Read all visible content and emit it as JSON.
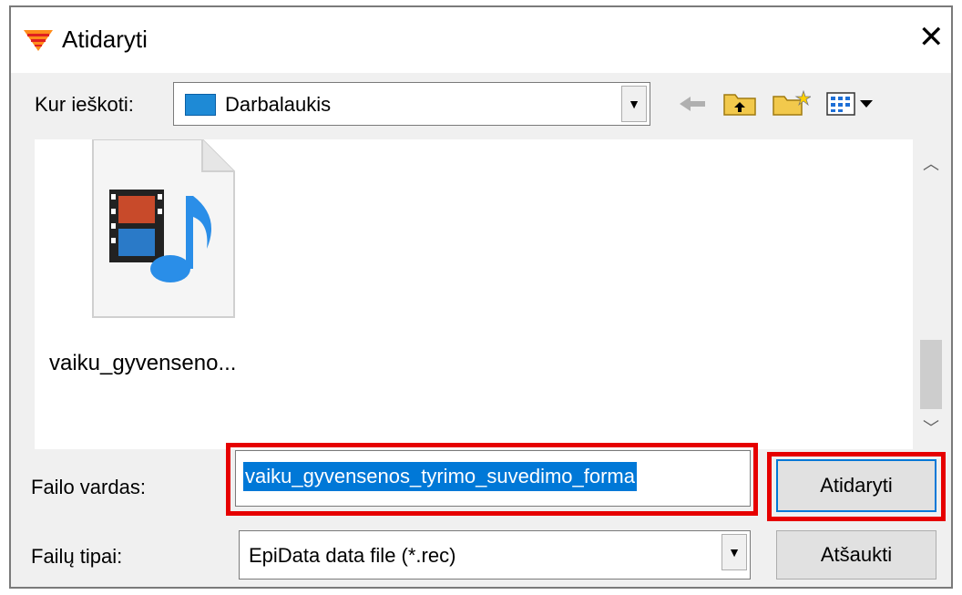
{
  "window": {
    "title": "Atidaryti",
    "close_glyph": "✕"
  },
  "toolbar": {
    "look_in_label": "Kur ieškoti:",
    "look_in_value": "Darbalaukis",
    "icons": [
      "back-arrow-icon",
      "up-folder-icon",
      "new-folder-icon",
      "view-menu-icon"
    ]
  },
  "file_list": {
    "items": [
      {
        "name": "vaiku_gyvenseno...",
        "icon": "media-file-icon"
      }
    ]
  },
  "filename": {
    "label": "Failo vardas:",
    "value": "vaiku_gyvensenos_tyrimo_suvedimo_forma"
  },
  "filetype": {
    "label": "Failų tipai:",
    "value": "EpiData data file (*.rec)"
  },
  "buttons": {
    "open": "Atidaryti",
    "cancel": "Atšaukti"
  },
  "colors": {
    "highlight": "#e60000",
    "selection": "#0078d7",
    "dialog_bg": "#f0f0f0"
  }
}
